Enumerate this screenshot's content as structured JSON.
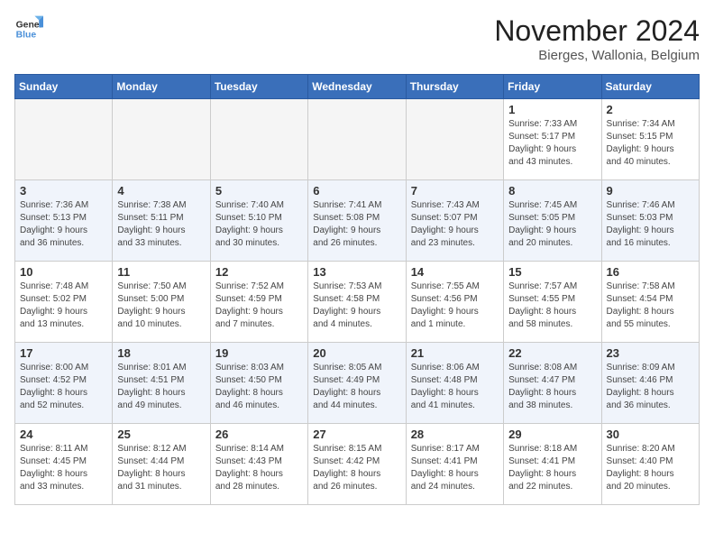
{
  "logo": {
    "line1": "General",
    "line2": "Blue"
  },
  "title": "November 2024",
  "subtitle": "Bierges, Wallonia, Belgium",
  "days_of_week": [
    "Sunday",
    "Monday",
    "Tuesday",
    "Wednesday",
    "Thursday",
    "Friday",
    "Saturday"
  ],
  "weeks": [
    [
      {
        "num": "",
        "info": ""
      },
      {
        "num": "",
        "info": ""
      },
      {
        "num": "",
        "info": ""
      },
      {
        "num": "",
        "info": ""
      },
      {
        "num": "",
        "info": ""
      },
      {
        "num": "1",
        "info": "Sunrise: 7:33 AM\nSunset: 5:17 PM\nDaylight: 9 hours\nand 43 minutes."
      },
      {
        "num": "2",
        "info": "Sunrise: 7:34 AM\nSunset: 5:15 PM\nDaylight: 9 hours\nand 40 minutes."
      }
    ],
    [
      {
        "num": "3",
        "info": "Sunrise: 7:36 AM\nSunset: 5:13 PM\nDaylight: 9 hours\nand 36 minutes."
      },
      {
        "num": "4",
        "info": "Sunrise: 7:38 AM\nSunset: 5:11 PM\nDaylight: 9 hours\nand 33 minutes."
      },
      {
        "num": "5",
        "info": "Sunrise: 7:40 AM\nSunset: 5:10 PM\nDaylight: 9 hours\nand 30 minutes."
      },
      {
        "num": "6",
        "info": "Sunrise: 7:41 AM\nSunset: 5:08 PM\nDaylight: 9 hours\nand 26 minutes."
      },
      {
        "num": "7",
        "info": "Sunrise: 7:43 AM\nSunset: 5:07 PM\nDaylight: 9 hours\nand 23 minutes."
      },
      {
        "num": "8",
        "info": "Sunrise: 7:45 AM\nSunset: 5:05 PM\nDaylight: 9 hours\nand 20 minutes."
      },
      {
        "num": "9",
        "info": "Sunrise: 7:46 AM\nSunset: 5:03 PM\nDaylight: 9 hours\nand 16 minutes."
      }
    ],
    [
      {
        "num": "10",
        "info": "Sunrise: 7:48 AM\nSunset: 5:02 PM\nDaylight: 9 hours\nand 13 minutes."
      },
      {
        "num": "11",
        "info": "Sunrise: 7:50 AM\nSunset: 5:00 PM\nDaylight: 9 hours\nand 10 minutes."
      },
      {
        "num": "12",
        "info": "Sunrise: 7:52 AM\nSunset: 4:59 PM\nDaylight: 9 hours\nand 7 minutes."
      },
      {
        "num": "13",
        "info": "Sunrise: 7:53 AM\nSunset: 4:58 PM\nDaylight: 9 hours\nand 4 minutes."
      },
      {
        "num": "14",
        "info": "Sunrise: 7:55 AM\nSunset: 4:56 PM\nDaylight: 9 hours\nand 1 minute."
      },
      {
        "num": "15",
        "info": "Sunrise: 7:57 AM\nSunset: 4:55 PM\nDaylight: 8 hours\nand 58 minutes."
      },
      {
        "num": "16",
        "info": "Sunrise: 7:58 AM\nSunset: 4:54 PM\nDaylight: 8 hours\nand 55 minutes."
      }
    ],
    [
      {
        "num": "17",
        "info": "Sunrise: 8:00 AM\nSunset: 4:52 PM\nDaylight: 8 hours\nand 52 minutes."
      },
      {
        "num": "18",
        "info": "Sunrise: 8:01 AM\nSunset: 4:51 PM\nDaylight: 8 hours\nand 49 minutes."
      },
      {
        "num": "19",
        "info": "Sunrise: 8:03 AM\nSunset: 4:50 PM\nDaylight: 8 hours\nand 46 minutes."
      },
      {
        "num": "20",
        "info": "Sunrise: 8:05 AM\nSunset: 4:49 PM\nDaylight: 8 hours\nand 44 minutes."
      },
      {
        "num": "21",
        "info": "Sunrise: 8:06 AM\nSunset: 4:48 PM\nDaylight: 8 hours\nand 41 minutes."
      },
      {
        "num": "22",
        "info": "Sunrise: 8:08 AM\nSunset: 4:47 PM\nDaylight: 8 hours\nand 38 minutes."
      },
      {
        "num": "23",
        "info": "Sunrise: 8:09 AM\nSunset: 4:46 PM\nDaylight: 8 hours\nand 36 minutes."
      }
    ],
    [
      {
        "num": "24",
        "info": "Sunrise: 8:11 AM\nSunset: 4:45 PM\nDaylight: 8 hours\nand 33 minutes."
      },
      {
        "num": "25",
        "info": "Sunrise: 8:12 AM\nSunset: 4:44 PM\nDaylight: 8 hours\nand 31 minutes."
      },
      {
        "num": "26",
        "info": "Sunrise: 8:14 AM\nSunset: 4:43 PM\nDaylight: 8 hours\nand 28 minutes."
      },
      {
        "num": "27",
        "info": "Sunrise: 8:15 AM\nSunset: 4:42 PM\nDaylight: 8 hours\nand 26 minutes."
      },
      {
        "num": "28",
        "info": "Sunrise: 8:17 AM\nSunset: 4:41 PM\nDaylight: 8 hours\nand 24 minutes."
      },
      {
        "num": "29",
        "info": "Sunrise: 8:18 AM\nSunset: 4:41 PM\nDaylight: 8 hours\nand 22 minutes."
      },
      {
        "num": "30",
        "info": "Sunrise: 8:20 AM\nSunset: 4:40 PM\nDaylight: 8 hours\nand 20 minutes."
      }
    ]
  ]
}
